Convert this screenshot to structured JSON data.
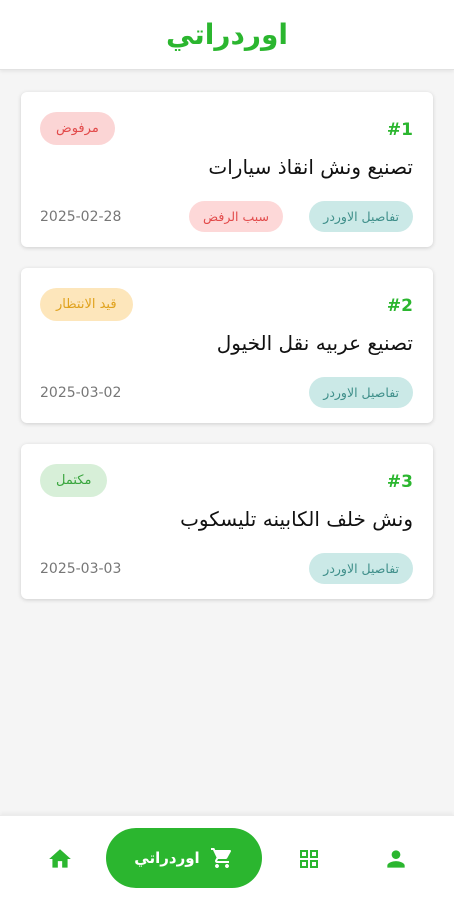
{
  "header": {
    "title": "اوردراتي"
  },
  "orders": [
    {
      "number": "#1",
      "title": "تصنيع ونش انقاذ سيارات",
      "status": "مرفوض",
      "status_bg": "#fbd5d5",
      "status_fg": "#e24a4a",
      "date": "2025-02-28",
      "details_label": "تفاصيل الاوردر",
      "reason_label": "سبب الرفض"
    },
    {
      "number": "#2",
      "title": "تصنيع عربيه نقل الخيول",
      "status": "قيد الانتظار",
      "status_bg": "#fde6bb",
      "status_fg": "#e0a21d",
      "date": "2025-03-02",
      "details_label": "تفاصيل الاوردر"
    },
    {
      "number": "#3",
      "title": "ونش خلف الكابينه تليسكوب",
      "status": "مكتمل",
      "status_bg": "#d7efd8",
      "status_fg": "#3aa63f",
      "date": "2025-03-03",
      "details_label": "تفاصيل الاوردر"
    }
  ],
  "bottom_nav": {
    "active_label": "اوردراتي",
    "items": [
      "home-icon",
      "cart-icon",
      "grid-icon",
      "person-icon"
    ]
  },
  "colors": {
    "brand": "#2bb62f",
    "details_bg": "#cbe9e7",
    "details_fg": "#3f8f8a"
  }
}
